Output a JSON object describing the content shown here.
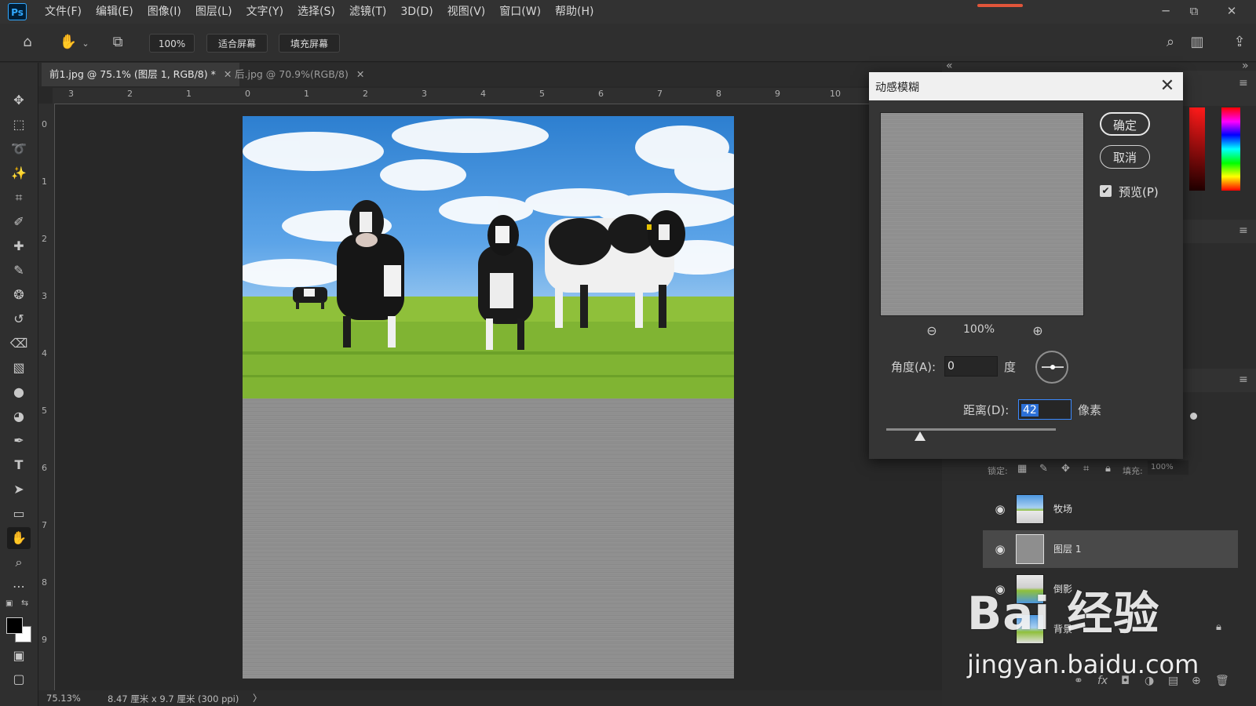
{
  "app": {
    "logo": "Ps"
  },
  "menu": [
    "文件(F)",
    "编辑(E)",
    "图像(I)",
    "图层(L)",
    "文字(Y)",
    "选择(S)",
    "滤镜(T)",
    "3D(D)",
    "视图(V)",
    "窗口(W)",
    "帮助(H)"
  ],
  "options_bar": {
    "zoom": "100%",
    "fit_screen": "适合屏幕",
    "fill_screen": "填充屏幕"
  },
  "tabs": [
    {
      "label": "前1.jpg @ 75.1% (图层 1, RGB/8) *",
      "active": true
    },
    {
      "label": "后.jpg @ 70.9%(RGB/8)",
      "active": false
    }
  ],
  "ruler_top": [
    "3",
    "2",
    "1",
    "0",
    "1",
    "2",
    "3",
    "4",
    "5",
    "6",
    "7",
    "8",
    "9",
    "10"
  ],
  "ruler_left": [
    "0",
    "1",
    "2",
    "3",
    "4",
    "5",
    "6",
    "7",
    "8",
    "9"
  ],
  "status": {
    "zoom": "75.13%",
    "doc_size": "8.47 厘米 x 9.7 厘米 (300 ppi)",
    "arrow": "〉"
  },
  "dialog": {
    "title": "动感模糊",
    "ok": "确定",
    "cancel": "取消",
    "preview_label": "预览(P)",
    "preview_checked": true,
    "zoom": "100%",
    "angle_label": "角度(A):",
    "angle_value": "0",
    "angle_unit": "度",
    "distance_label": "距离(D):",
    "distance_value": "42",
    "distance_unit": "像素",
    "distance_slider_fraction": 0.2
  },
  "layers_panel": {
    "lock_label": "锁定:",
    "fill_label": "填充:",
    "fill_value": "100%",
    "layers": [
      {
        "name": "牧场",
        "selected": false
      },
      {
        "name": "图层 1",
        "selected": true
      },
      {
        "name": "倒影",
        "selected": false
      },
      {
        "name": "背景",
        "selected": false
      }
    ]
  },
  "watermark": {
    "brand": "Bai 经验",
    "url": "jingyan.baidu.com"
  },
  "colors": {
    "accent_blue": "#3b89ff",
    "ps_blue": "#31a8ff",
    "panel_bg": "#2c2c2c",
    "selected_row": "#494949"
  },
  "icons": {
    "toolbar": [
      "move-icon",
      "marquee-icon",
      "lasso-icon",
      "magic-wand-icon",
      "crop-icon",
      "eyedropper-icon",
      "healing-brush-icon",
      "brush-icon",
      "stamp-icon",
      "history-brush-icon",
      "eraser-icon",
      "gradient-icon",
      "blur-icon",
      "dodge-icon",
      "pen-icon",
      "type-icon",
      "path-select-icon",
      "rectangle-icon",
      "hand-icon",
      "zoom-icon",
      "more-tools-icon"
    ]
  }
}
